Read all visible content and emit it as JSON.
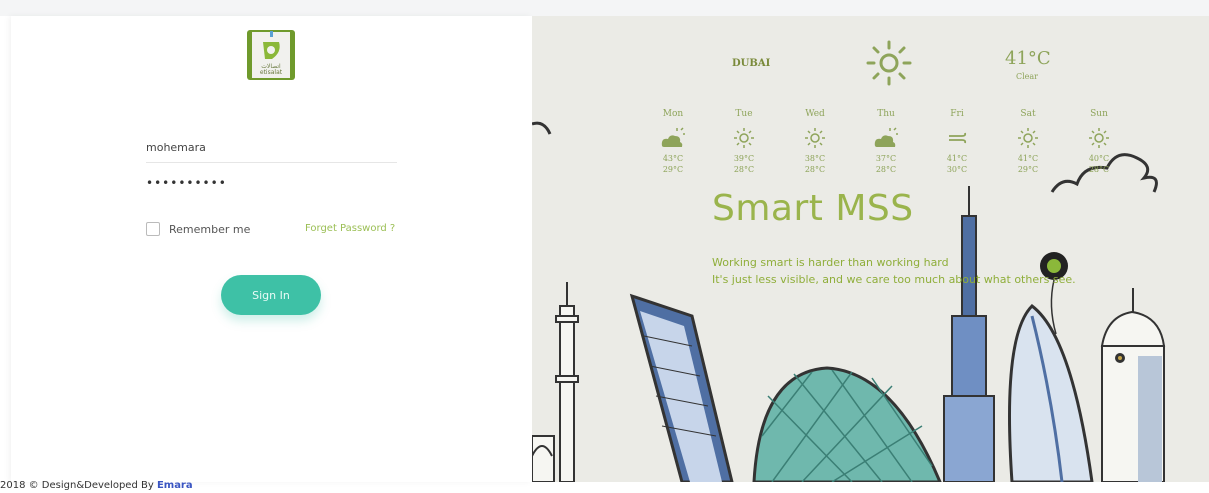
{
  "login": {
    "username_value": "mohemara",
    "password_value": "••••••••••",
    "remember_label": "Remember me",
    "forget_label": "Forget Password ?",
    "signin_label": "Sign In",
    "logo_icon": "etisalat-logo"
  },
  "footer": {
    "text": "2018 © Design&Developed By ",
    "brand": "Emara"
  },
  "weather": {
    "city": "DUBAI",
    "temp": "41°C",
    "condition": "Clear",
    "main_icon": "sun-icon",
    "days": [
      {
        "name": "Mon",
        "icon": "cloud-sun-icon",
        "hi": "43°C",
        "lo": "29°C"
      },
      {
        "name": "Tue",
        "icon": "sun-icon",
        "hi": "39°C",
        "lo": "28°C"
      },
      {
        "name": "Wed",
        "icon": "sun-icon",
        "hi": "38°C",
        "lo": "28°C"
      },
      {
        "name": "Thu",
        "icon": "cloud-sun-icon",
        "hi": "37°C",
        "lo": "28°C"
      },
      {
        "name": "Fri",
        "icon": "wind-icon",
        "hi": "41°C",
        "lo": "30°C"
      },
      {
        "name": "Sat",
        "icon": "sun-icon",
        "hi": "41°C",
        "lo": "29°C"
      },
      {
        "name": "Sun",
        "icon": "sun-icon",
        "hi": "40°C",
        "lo": "28°C"
      }
    ]
  },
  "hero": {
    "title": "Smart MSS",
    "line1": "Working smart is harder than working hard",
    "line2": "It's just less visible, and we care too much about what others see."
  },
  "colors": {
    "accent": "#3ec1a6",
    "green_text": "#9ab44c",
    "footer_brand": "#3a55c2"
  }
}
